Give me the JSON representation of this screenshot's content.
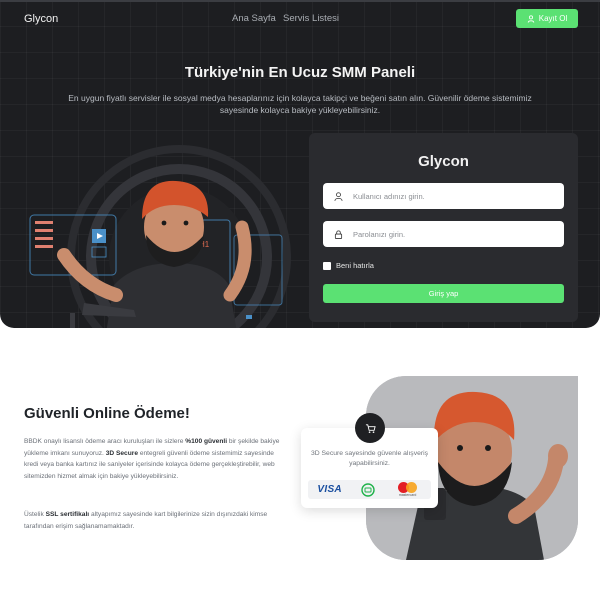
{
  "header": {
    "brand": "Glycon",
    "nav": [
      "Ana Sayfa",
      "Servis Listesi"
    ],
    "register_label": "Kayıt Ol"
  },
  "hero": {
    "title": "Türkiye'nin En Ucuz SMM Paneli",
    "subtitle": "En uygun fiyatlı servisler ile sosyal medya hesaplarınız için kolayca takipçi ve beğeni satın alın. Güvenilir ödeme sistemimiz sayesinde kolayca bakiye yükleyebilirsiniz.",
    "art_label": "H1"
  },
  "login": {
    "title": "Glycon",
    "username_placeholder": "Kullanıcı adınızı girin.",
    "password_placeholder": "Parolanızı girin.",
    "remember_label": "Beni hatırla",
    "submit_label": "Giriş yap"
  },
  "secure": {
    "title": "Güvenli Online Ödeme!",
    "p1_a": "BBDK onaylı lisanslı ödeme aracı kuruluşları ile sizlere ",
    "p1_b": "%100 güvenli",
    "p1_c": " bir şekilde bakiye yükleme imkanı sunuyoruz. ",
    "p1_d": "3D Secure",
    "p1_e": " entegreli güvenli ödeme sistemimiz sayesinde kredi veya banka kartınız ile saniyeler içerisinde kolayca ödeme gerçekleştirebilir, web sitemizden hizmet almak için bakiye yükleyebilirsiniz.",
    "p2_a": "Üstelik ",
    "p2_b": "SSL sertifikalı",
    "p2_c": " altyapımız sayesinde kart bilgilerinize sizin dışınızdaki kimse tarafından erişim sağlanamamaktadır.",
    "card_text": "3D Secure sayesinde güvenle alışveriş yapabilirsiniz.",
    "visa_label": "VISA",
    "mastercard_label": "mastercard"
  },
  "colors": {
    "accent": "#5be173",
    "hero_bg": "#1d1e21",
    "card_bg": "#2a2b2f"
  },
  "icons": {
    "register": "user-icon",
    "username": "user-icon",
    "password": "lock-icon",
    "cart": "cart-icon"
  }
}
